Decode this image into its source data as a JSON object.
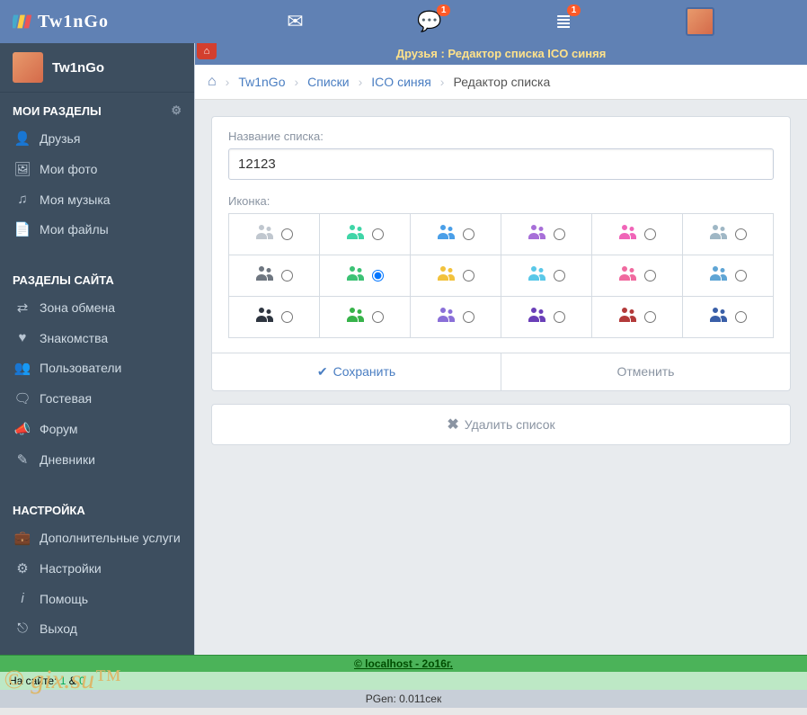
{
  "brand": "Tw1nGo",
  "topbar": {
    "chat_badge": "1",
    "notif_badge": "1"
  },
  "sidebar": {
    "username": "Tw1nGo",
    "section1_title": "МОИ РАЗДЕЛЫ",
    "section1": [
      {
        "label": "Друзья"
      },
      {
        "label": "Мои фото"
      },
      {
        "label": "Моя музыка"
      },
      {
        "label": "Мои файлы"
      }
    ],
    "section2_title": "РАЗДЕЛЫ САЙТА",
    "section2": [
      {
        "label": "Зона обмена"
      },
      {
        "label": "Знакомства"
      },
      {
        "label": "Пользователи"
      },
      {
        "label": "Гостевая"
      },
      {
        "label": "Форум"
      },
      {
        "label": "Дневники"
      }
    ],
    "section3_title": "НАСТРОЙКА",
    "section3": [
      {
        "label": "Дополнительные услуги"
      },
      {
        "label": "Настройки"
      },
      {
        "label": "Помощь"
      },
      {
        "label": "Выход"
      }
    ]
  },
  "page": {
    "title_bar": "Друзья : Редактор списка ICO синяя",
    "breadcrumb": {
      "links": [
        "Tw1nGo",
        "Списки",
        "ICO синяя"
      ],
      "current": "Редактор списка"
    },
    "list_name_label": "Название списка:",
    "list_name_value": "12123",
    "icon_label": "Иконка:",
    "icon_colors": [
      [
        "#c0c7cf",
        "#3fd5a7",
        "#4a9fe8",
        "#a76fd8",
        "#f065b8",
        "#9fb7c5"
      ],
      [
        "#6e7680",
        "#3cc275",
        "#f2c23d",
        "#5ac8e8",
        "#f06a9f",
        "#5fa5d5"
      ],
      [
        "#2e3540",
        "#37b34a",
        "#8a6fd8",
        "#6a3fb8",
        "#b33a3a",
        "#3a5fa8"
      ]
    ],
    "selected_row": 1,
    "selected_col": 1,
    "save_label": "Сохранить",
    "cancel_label": "Отменить",
    "delete_label": "Удалить список"
  },
  "footer": {
    "copyright": "© localhost - 2o16г.",
    "online_prefix": "На сайте: ",
    "online_a": "1",
    "online_sep": " & ",
    "online_b": "0",
    "pgen": "PGen: 0.011сек",
    "watermark": "© gix.su™"
  }
}
